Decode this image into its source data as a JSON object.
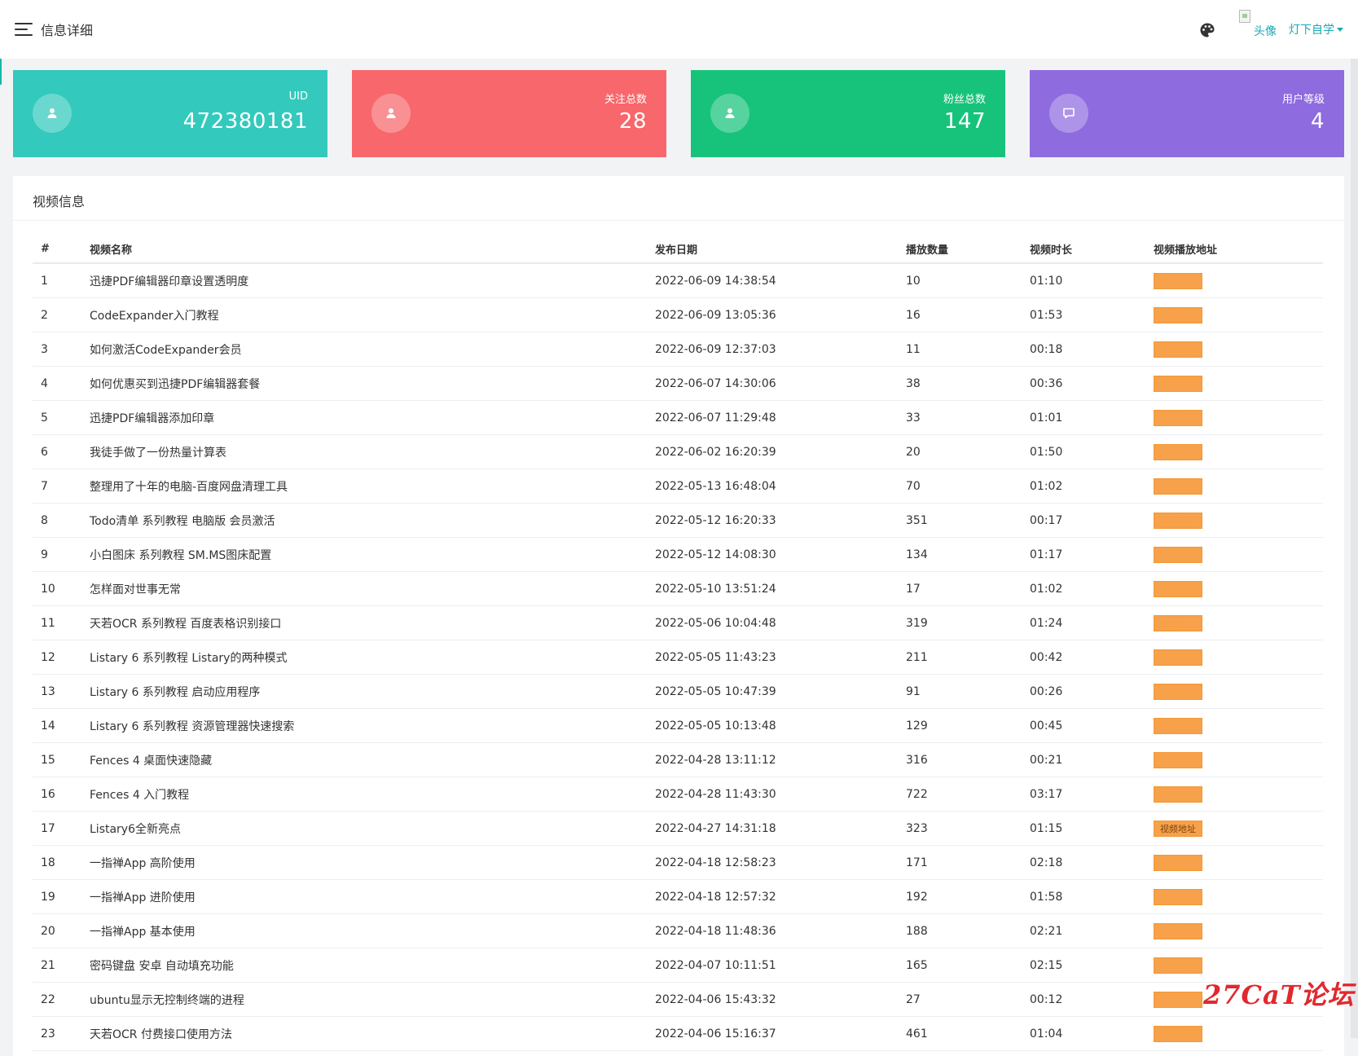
{
  "header": {
    "title": "信息详细",
    "avatar_alt": "头像",
    "user_name": "灯下自学"
  },
  "colors": {
    "uid_card": "#33c9bd",
    "follow_card": "#f7676b",
    "fans_card": "#17c37b",
    "level_card": "#8e6bdf",
    "accent": "#1aa7b5",
    "link_button": "#f7a14a"
  },
  "stats": [
    {
      "label": "UID",
      "value": "472380181",
      "icon": "user-icon"
    },
    {
      "label": "关注总数",
      "value": "28",
      "icon": "user-icon"
    },
    {
      "label": "粉丝总数",
      "value": "147",
      "icon": "user-icon"
    },
    {
      "label": "用户等级",
      "value": "4",
      "icon": "message-icon"
    }
  ],
  "panel": {
    "title": "视频信息",
    "columns": [
      "#",
      "视频名称",
      "发布日期",
      "播放数量",
      "视频时长",
      "视频播放地址"
    ],
    "link_label": "视频地址",
    "rows": [
      [
        "1",
        "迅捷PDF编辑器印章设置透明度",
        "2022-06-09 14:38:54",
        "10",
        "01:10"
      ],
      [
        "2",
        "CodeExpander入门教程",
        "2022-06-09 13:05:36",
        "16",
        "01:53"
      ],
      [
        "3",
        "如何激活CodeExpander会员",
        "2022-06-09 12:37:03",
        "11",
        "00:18"
      ],
      [
        "4",
        "如何优惠买到迅捷PDF编辑器套餐",
        "2022-06-07 14:30:06",
        "38",
        "00:36"
      ],
      [
        "5",
        "迅捷PDF编辑器添加印章",
        "2022-06-07 11:29:48",
        "33",
        "01:01"
      ],
      [
        "6",
        "我徒手做了一份热量计算表",
        "2022-06-02 16:20:39",
        "20",
        "01:50"
      ],
      [
        "7",
        "整理用了十年的电脑-百度网盘清理工具",
        "2022-05-13 16:48:04",
        "70",
        "01:02"
      ],
      [
        "8",
        "Todo清单 系列教程 电脑版 会员激活",
        "2022-05-12 16:20:33",
        "351",
        "00:17"
      ],
      [
        "9",
        "小白图床 系列教程 SM.MS图床配置",
        "2022-05-12 14:08:30",
        "134",
        "01:17"
      ],
      [
        "10",
        "怎样面对世事无常",
        "2022-05-10 13:51:24",
        "17",
        "01:02"
      ],
      [
        "11",
        "天若OCR 系列教程 百度表格识别接口",
        "2022-05-06 10:04:48",
        "319",
        "01:24"
      ],
      [
        "12",
        "Listary 6 系列教程 Listary的两种模式",
        "2022-05-05 11:43:23",
        "211",
        "00:42"
      ],
      [
        "13",
        "Listary 6 系列教程 启动应用程序",
        "2022-05-05 10:47:39",
        "91",
        "00:26"
      ],
      [
        "14",
        "Listary 6 系列教程 资源管理器快速搜索",
        "2022-05-05 10:13:48",
        "129",
        "00:45"
      ],
      [
        "15",
        "Fences 4 桌面快速隐藏",
        "2022-04-28 13:11:12",
        "316",
        "00:21"
      ],
      [
        "16",
        "Fences 4 入门教程",
        "2022-04-28 11:43:30",
        "722",
        "03:17"
      ],
      [
        "17",
        "Listary6全新亮点",
        "2022-04-27 14:31:18",
        "323",
        "01:15"
      ],
      [
        "18",
        "一指禅App 高阶使用",
        "2022-04-18 12:58:23",
        "171",
        "02:18"
      ],
      [
        "19",
        "一指禅App 进阶使用",
        "2022-04-18 12:57:32",
        "192",
        "01:58"
      ],
      [
        "20",
        "一指禅App 基本使用",
        "2022-04-18 11:48:36",
        "188",
        "02:21"
      ],
      [
        "21",
        "密码键盘 安卓 自动填充功能",
        "2022-04-07 10:11:51",
        "165",
        "02:15"
      ],
      [
        "22",
        "ubuntu显示无控制终端的进程",
        "2022-04-06 15:43:32",
        "27",
        "00:12"
      ],
      [
        "23",
        "天若OCR 付费接口使用方法",
        "2022-04-06 15:16:37",
        "461",
        "01:04"
      ]
    ],
    "active_row": "17"
  },
  "watermark": "27CaT论坛"
}
